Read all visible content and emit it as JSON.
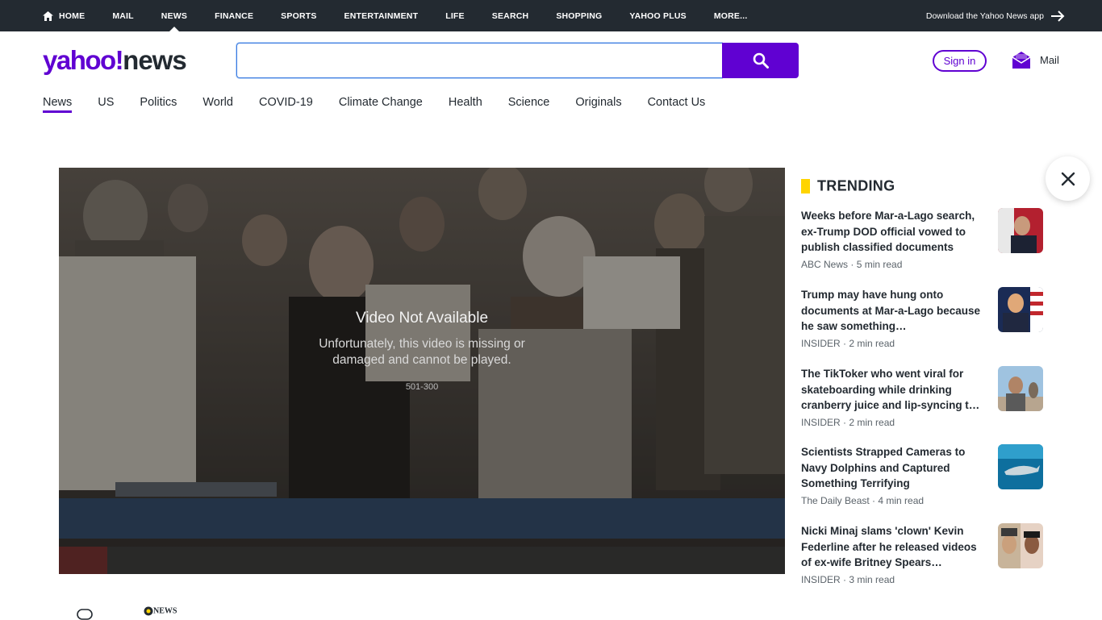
{
  "topnav": {
    "items": [
      {
        "label": "HOME",
        "icon": "home-icon"
      },
      {
        "label": "MAIL"
      },
      {
        "label": "NEWS",
        "active": true
      },
      {
        "label": "FINANCE"
      },
      {
        "label": "SPORTS"
      },
      {
        "label": "ENTERTAINMENT"
      },
      {
        "label": "LIFE"
      },
      {
        "label": "SEARCH"
      },
      {
        "label": "SHOPPING"
      },
      {
        "label": "YAHOO PLUS"
      },
      {
        "label": "MORE..."
      }
    ],
    "download_app": "Download the Yahoo News app"
  },
  "header": {
    "logo_yahoo": "yahoo!",
    "logo_news": "news",
    "search_value": "",
    "search_placeholder": "",
    "signin_label": "Sign in",
    "mail_label": "Mail"
  },
  "subnav": {
    "items": [
      "News",
      "US",
      "Politics",
      "World",
      "COVID-19",
      "Climate Change",
      "Health",
      "Science",
      "Originals",
      "Contact Us"
    ],
    "active": "News"
  },
  "video": {
    "title": "Video Not Available",
    "message": "Unfortunately, this video is missing or damaged and cannot be played.",
    "code": "501-300"
  },
  "trending": {
    "heading": "TRENDING",
    "items": [
      {
        "title": "Weeks before Mar-a-Lago search, ex-Trump DOD official vowed to publish classified documents fro…",
        "source": "ABC News",
        "read": "5 min read",
        "thumb": "man-speaking-red-backdrop"
      },
      {
        "title": "Trump may have hung onto documents at Mar-a-Lago because he saw something…",
        "source": "INSIDER",
        "read": "2 min read",
        "thumb": "man-with-flag"
      },
      {
        "title": "The TikToker who went viral for skateboarding while drinking cranberry juice and lip-syncing t…",
        "source": "INSIDER",
        "read": "2 min read",
        "thumb": "man-outdoors-sky"
      },
      {
        "title": "Scientists Strapped Cameras to Navy Dolphins and Captured Something Terrifying",
        "source": "The Daily Beast",
        "read": "4 min read",
        "thumb": "dolphin-underwater"
      },
      {
        "title": "Nicki Minaj slams 'clown' Kevin Federline after he released videos of ex-wife Britney Spears…",
        "source": "INSIDER",
        "read": "3 min read",
        "thumb": "two-portraits"
      }
    ],
    "meta_separator": " · "
  },
  "colors": {
    "brand_purple": "#6001d2",
    "topbar_bg": "#232a31",
    "trending_accent": "#ffd400"
  },
  "footer": {
    "abc_label": "NEWS"
  }
}
